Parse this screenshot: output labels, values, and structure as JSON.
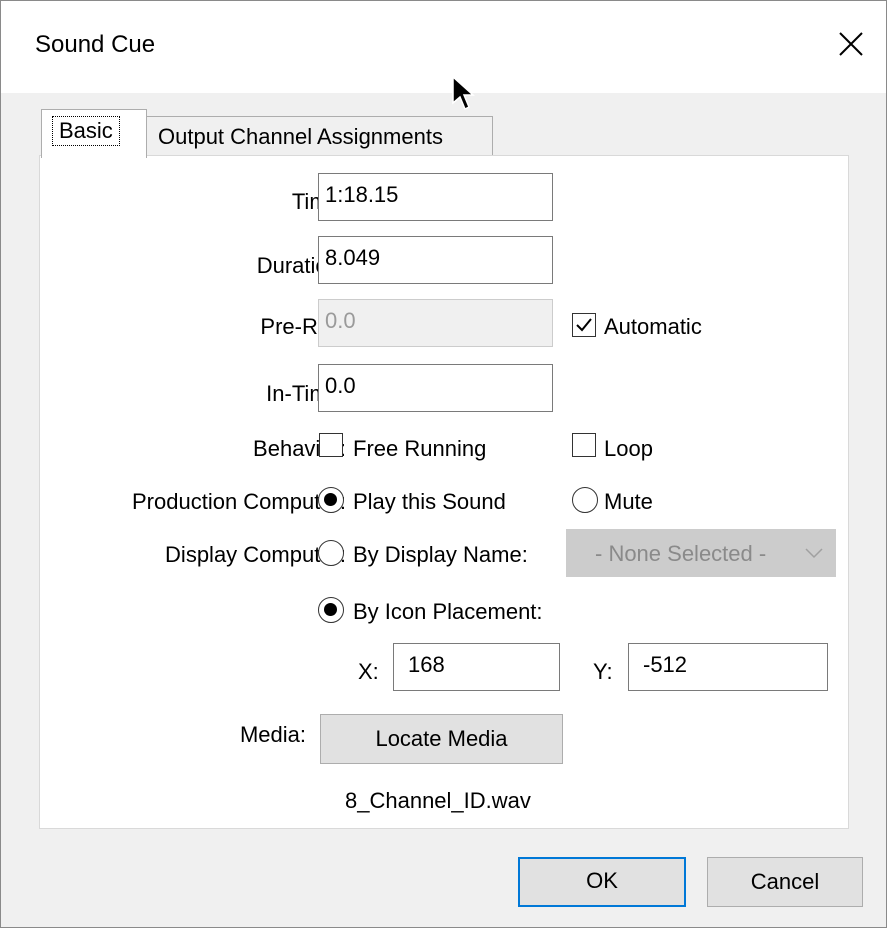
{
  "window": {
    "title": "Sound Cue",
    "close_icon": "close-icon"
  },
  "tabs": [
    {
      "label": "Basic",
      "active": true
    },
    {
      "label": "Output Channel Assignments",
      "active": false
    }
  ],
  "form": {
    "time": {
      "label": "Time:",
      "value": "1:18.15"
    },
    "duration": {
      "label": "Duration:",
      "value": "8.049"
    },
    "preroll": {
      "label": "Pre-Roll:",
      "value": "0.0",
      "disabled": true,
      "automatic_label": "Automatic",
      "automatic_checked": true
    },
    "intime": {
      "label": "In-Time:",
      "value": "0.0"
    },
    "behavior": {
      "label": "Behavior:",
      "free_running_label": "Free Running",
      "free_running_checked": false,
      "loop_label": "Loop",
      "loop_checked": false
    },
    "production": {
      "label": "Production Computer:",
      "play_label": "Play this Sound",
      "play_selected": true,
      "mute_label": "Mute",
      "mute_selected": false
    },
    "display": {
      "label": "Display Computer:",
      "by_name_label": "By Display Name:",
      "by_name_selected": false,
      "name_select_value": "- None Selected -",
      "by_icon_label": "By Icon Placement:",
      "by_icon_selected": true,
      "x_label": "X:",
      "x_value": "168",
      "y_label": "Y:",
      "y_value": "-512"
    },
    "media": {
      "label": "Media:",
      "button_label": "Locate Media",
      "filename": "8_Channel_ID.wav"
    }
  },
  "buttons": {
    "ok": "OK",
    "cancel": "Cancel"
  },
  "colors": {
    "accent": "#0078d7",
    "panel": "#ffffff",
    "background": "#f0f0f0"
  }
}
